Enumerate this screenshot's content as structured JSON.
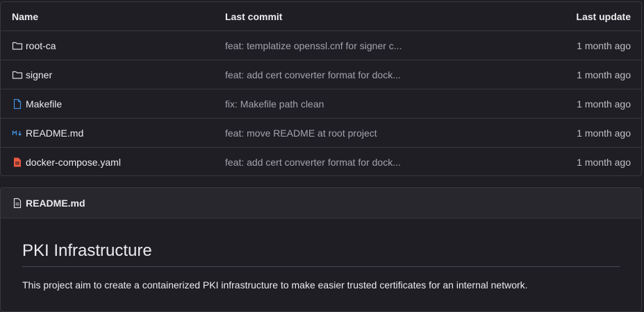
{
  "table": {
    "headers": {
      "name": "Name",
      "commit": "Last commit",
      "update": "Last update"
    },
    "rows": [
      {
        "name": "root-ca",
        "icon": "folder-icon",
        "commit": "feat: templatize openssl.cnf for signer c...",
        "update": "1 month ago"
      },
      {
        "name": "signer",
        "icon": "folder-icon",
        "commit": "feat: add cert converter format for dock...",
        "update": "1 month ago"
      },
      {
        "name": "Makefile",
        "icon": "file-icon",
        "commit": "fix: Makefile path clean",
        "update": "1 month ago"
      },
      {
        "name": "README.md",
        "icon": "markdown-icon",
        "commit": "feat: move README at root project",
        "update": "1 month ago"
      },
      {
        "name": "docker-compose.yaml",
        "icon": "yaml-file-icon",
        "commit": "feat: add cert converter format for dock...",
        "update": "1 month ago"
      }
    ]
  },
  "readme": {
    "filename": "README.md",
    "title": "PKI Infrastructure",
    "text": "This project aim to create a containerized PKI infrastructure to make easier trusted certificates for an internal network."
  },
  "colors": {
    "background": "#1f1e24",
    "border": "#3a383f",
    "file_blue": "#428fdc",
    "yaml_red": "#ec5941"
  }
}
